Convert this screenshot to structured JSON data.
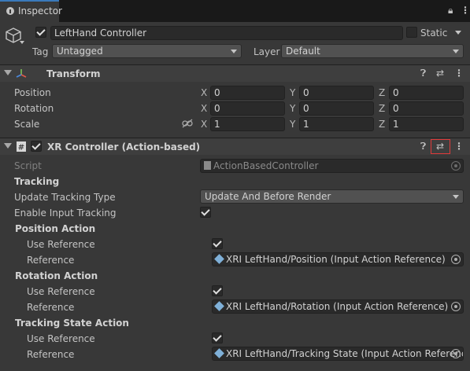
{
  "tab": {
    "label": "Inspector"
  },
  "header": {
    "object_name": "LeftHand Controller",
    "static_label": "Static",
    "tag_label": "Tag",
    "tag_value": "Untagged",
    "layer_label": "Layer",
    "layer_value": "Default"
  },
  "transform": {
    "title": "Transform",
    "rows": [
      {
        "label": "Position",
        "x": "0",
        "y": "0",
        "z": "0"
      },
      {
        "label": "Rotation",
        "x": "0",
        "y": "0",
        "z": "0"
      },
      {
        "label": "Scale",
        "x": "1",
        "y": "1",
        "z": "1"
      }
    ],
    "axis": {
      "x": "X",
      "y": "Y",
      "z": "Z"
    }
  },
  "xr": {
    "title": "XR Controller (Action-based)",
    "script_label": "Script",
    "script_value": "ActionBasedController",
    "tracking_header": "Tracking",
    "update_tracking_label": "Update Tracking Type",
    "update_tracking_value": "Update And Before Render",
    "enable_input_label": "Enable Input Tracking",
    "position_action_header": "Position Action",
    "rotation_action_header": "Rotation Action",
    "tracking_state_header": "Tracking State Action",
    "use_reference_label": "Use Reference",
    "reference_label": "Reference",
    "position_ref": "XRI LeftHand/Position (Input Action Reference)",
    "rotation_ref": "XRI LeftHand/Rotation (Input Action Reference)",
    "tracking_state_ref": "XRI LeftHand/Tracking State (Input Action Reference)"
  },
  "colors": {
    "highlight_box": "#e03a3a",
    "tab_accent": "#3a79bb"
  }
}
